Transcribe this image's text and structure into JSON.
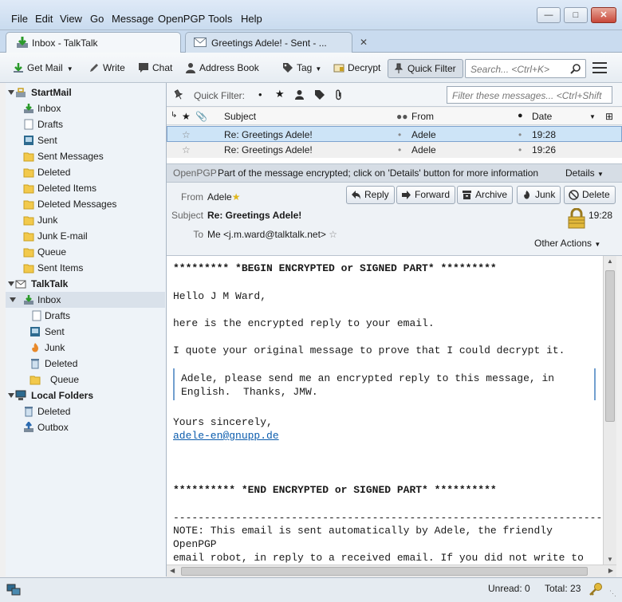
{
  "menubar": [
    "File",
    "Edit",
    "View",
    "Go",
    "Message",
    "OpenPGP",
    "Tools",
    "Help"
  ],
  "window_controls": [
    "minimize",
    "maximize",
    "close"
  ],
  "tabs": [
    {
      "label": "Inbox - TalkTalk",
      "icon": "inbox-download-icon"
    },
    {
      "label": "Greetings Adele! - Sent - ...",
      "icon": "envelope-icon"
    }
  ],
  "toolbar": {
    "get_mail": "Get Mail",
    "write": "Write",
    "chat": "Chat",
    "address_book": "Address Book",
    "tag": "Tag",
    "decrypt": "Decrypt",
    "quick_filter": "Quick Filter",
    "search_placeholder": "Search... <Ctrl+K>"
  },
  "folders": {
    "startmail": {
      "name": "StartMail",
      "items": [
        "Inbox",
        "Drafts",
        "Sent",
        "Sent Messages",
        "Deleted",
        "Deleted Items",
        "Deleted Messages",
        "Junk",
        "Junk E-mail",
        "Queue",
        "Sent Items"
      ]
    },
    "talktalk": {
      "name": "TalkTalk",
      "items": [
        "Inbox",
        "Drafts",
        "Sent",
        "Junk",
        "Deleted",
        "Queue"
      ]
    },
    "local": {
      "name": "Local Folders",
      "items": [
        "Deleted",
        "Outbox"
      ]
    }
  },
  "quickfilter": {
    "label": "Quick Filter:",
    "placeholder": "Filter these messages... <Ctrl+Shift"
  },
  "thread_columns": {
    "subject": "Subject",
    "from": "From",
    "date": "Date"
  },
  "messages": [
    {
      "subject": "Re: Greetings Adele!",
      "from": "Adele",
      "date": "19:28"
    },
    {
      "subject": "Re: Greetings Adele!",
      "from": "Adele",
      "date": "19:26"
    }
  ],
  "openpgp": {
    "label": "OpenPGP",
    "text": "Part of the message encrypted; click on 'Details' button for more information",
    "details": "Details"
  },
  "header": {
    "from_label": "From",
    "from_value": "Adele",
    "subject_label": "Subject",
    "subject_value": "Re: Greetings Adele!",
    "to_label": "To",
    "to_value": "Me <j.m.ward@talktalk.net>",
    "time": "19:28",
    "other_actions": "Other Actions"
  },
  "actions": {
    "reply": "Reply",
    "forward": "Forward",
    "archive": "Archive",
    "junk": "Junk",
    "delete": "Delete"
  },
  "body": {
    "begin": "********* *BEGIN ENCRYPTED or SIGNED PART* *********",
    "greeting": "Hello J M Ward,",
    "line1": "here is the encrypted reply to your email.",
    "line2": "I quote your original message to prove that I could decrypt it.",
    "quote1": "Adele, please send me an encrypted reply to this message, in",
    "quote2": "English.  Thanks, JMW.",
    "closing": "Yours sincerely,",
    "link": "adele-en@gnupp.de",
    "end": "********** *END ENCRYPTED or SIGNED PART* **********",
    "rule": "------------------------------------------------------------------------",
    "note1": "NOTE: This email is sent automatically by Adele, the friendly",
    "note2": "OpenPGP",
    "note3": "email robot, in reply to a received email. If you did not write to"
  },
  "status": {
    "unread": "Unread: 0",
    "total": "Total: 23"
  },
  "colors": {
    "accent": "#7da2ce",
    "link": "#0b5cad",
    "selection": "#cde4f7"
  }
}
